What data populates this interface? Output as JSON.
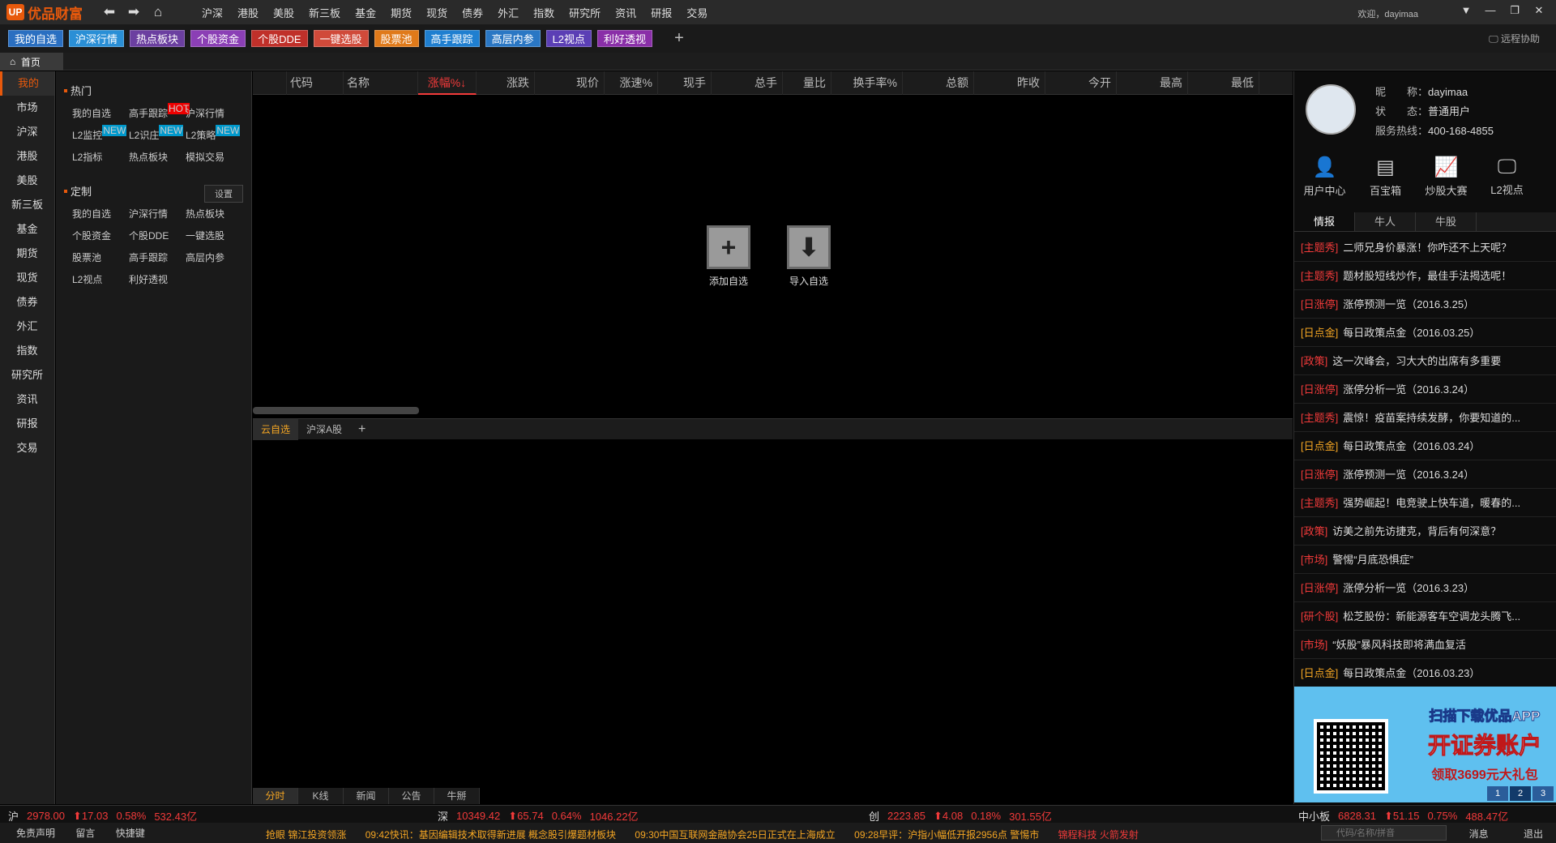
{
  "app": {
    "logo_badge": "UP",
    "logo_text": "优品财富",
    "back": "⬅",
    "forward": "➡",
    "home": "⌂"
  },
  "nav": [
    "沪深",
    "港股",
    "美股",
    "新三板",
    "基金",
    "期货",
    "现货",
    "债券",
    "外汇",
    "指数",
    "研究所",
    "资讯",
    "研报",
    "交易"
  ],
  "user_greeting": "欢迎，dayimaa",
  "window": {
    "menu": "▼",
    "min": "—",
    "restore": "❐",
    "close": "✕"
  },
  "toolbar": {
    "buttons": [
      {
        "label": "我的自选",
        "color": "#2a6fc1"
      },
      {
        "label": "沪深行情",
        "color": "#2a8fd6"
      },
      {
        "label": "热点板块",
        "color": "#6b3fa0"
      },
      {
        "label": "个股资金",
        "color": "#8b3fb5"
      },
      {
        "label": "个股DDE",
        "color": "#c0302a"
      },
      {
        "label": "一键选股",
        "color": "#d04a3a"
      },
      {
        "label": "股票池",
        "color": "#e07a1a"
      },
      {
        "label": "高手跟踪",
        "color": "#1f7fd0"
      },
      {
        "label": "高层内参",
        "color": "#2a77c4"
      },
      {
        "label": "L2视点",
        "color": "#5b3fb5"
      },
      {
        "label": "利好透视",
        "color": "#8a2fa8"
      }
    ],
    "plus": "+",
    "remote": "远程协助"
  },
  "home_tab": "首页",
  "leftnav": [
    "我的",
    "市场",
    "沪深",
    "港股",
    "美股",
    "新三板",
    "基金",
    "期货",
    "现货",
    "债券",
    "外汇",
    "指数",
    "研究所",
    "资讯",
    "研报",
    "交易"
  ],
  "panel": {
    "hot_title": "热门",
    "hot_items": [
      {
        "label": "我的自选",
        "badge": ""
      },
      {
        "label": "高手跟踪",
        "badge": "HOT"
      },
      {
        "label": "沪深行情",
        "badge": ""
      },
      {
        "label": "L2监控",
        "badge": "NEW"
      },
      {
        "label": "L2识庄",
        "badge": "NEW"
      },
      {
        "label": "L2策略",
        "badge": "NEW"
      },
      {
        "label": "L2指标",
        "badge": ""
      },
      {
        "label": "热点板块",
        "badge": ""
      },
      {
        "label": "模拟交易",
        "badge": ""
      }
    ],
    "custom_title": "定制",
    "settings": "设置",
    "custom_items": [
      "我的自选",
      "沪深行情",
      "热点板块",
      "个股资金",
      "个股DDE",
      "一键选股",
      "股票池",
      "高手跟踪",
      "高层内参",
      "L2视点",
      "利好透视"
    ]
  },
  "table": {
    "columns": [
      "代码",
      "名称",
      "涨幅%↓",
      "涨跌",
      "现价",
      "涨速%",
      "现手",
      "总手",
      "量比",
      "换手率%",
      "总额",
      "昨收",
      "今开",
      "最高",
      "最低"
    ]
  },
  "actions": {
    "add": "添加自选",
    "import": "导入自选"
  },
  "subtabs": [
    "云自选",
    "沪深A股",
    "+"
  ],
  "bottomtabs": [
    "分时",
    "K线",
    "新闻",
    "公告",
    "牛掰"
  ],
  "profile": {
    "nick_label": "昵　　称：",
    "nick": "dayimaa",
    "status_label": "状　　态：",
    "status": "普通用户",
    "hotline_label": "服务热线：",
    "hotline": "400-168-4855"
  },
  "quick": [
    {
      "label": "用户中心",
      "icon": "person-icon"
    },
    {
      "label": "百宝箱",
      "icon": "box-icon"
    },
    {
      "label": "炒股大赛",
      "icon": "chart-icon"
    },
    {
      "label": "L2视点",
      "icon": "monitor-icon"
    }
  ],
  "rtabs": [
    "情报",
    "牛人",
    "牛股"
  ],
  "news": [
    {
      "tag": "[主题秀]",
      "text": "二师兄身价暴涨！你咋还不上天呢？",
      "color": "#f23a3a"
    },
    {
      "tag": "[主题秀]",
      "text": "题材股短线炒作，最佳手法揭选呢！",
      "color": "#f23a3a"
    },
    {
      "tag": "[日涨停]",
      "text": "涨停预测一览（2016.3.25）",
      "color": "#f23a3a"
    },
    {
      "tag": "[日点金]",
      "text": "每日政策点金（2016.03.25）",
      "color": "#f5a623"
    },
    {
      "tag": "[政策]",
      "text": "这一次峰会，习大大的出席有多重要",
      "color": "#f23a3a"
    },
    {
      "tag": "[日涨停]",
      "text": "涨停分析一览（2016.3.24）",
      "color": "#f23a3a"
    },
    {
      "tag": "[主题秀]",
      "text": "震惊！疫苗案持续发酵，你要知道的...",
      "color": "#f23a3a"
    },
    {
      "tag": "[日点金]",
      "text": "每日政策点金（2016.03.24）",
      "color": "#f5a623"
    },
    {
      "tag": "[日涨停]",
      "text": "涨停预测一览（2016.3.24）",
      "color": "#f23a3a"
    },
    {
      "tag": "[主题秀]",
      "text": "强势崛起！电竞驶上快车道，暖春的...",
      "color": "#f23a3a"
    },
    {
      "tag": "[政策]",
      "text": "访美之前先访捷克，背后有何深意？",
      "color": "#f23a3a"
    },
    {
      "tag": "[市场]",
      "text": "警惕“月底恐惧症”",
      "color": "#f23a3a"
    },
    {
      "tag": "[日涨停]",
      "text": "涨停分析一览（2016.3.23）",
      "color": "#f23a3a"
    },
    {
      "tag": "[研个股]",
      "text": "松芝股份：新能源客车空调龙头腾飞...",
      "color": "#f23a3a"
    },
    {
      "tag": "[市场]",
      "text": "“妖股”暴风科技即将满血复活",
      "color": "#f23a3a"
    },
    {
      "tag": "[日点金]",
      "text": "每日政策点金（2016.03.23）",
      "color": "#f5a623"
    }
  ],
  "ad": {
    "line1": "扫描下载优品APP",
    "line2": "开证券账户",
    "line3": "领取3699元大礼包",
    "pages": [
      "1",
      "2",
      "3"
    ]
  },
  "indices": [
    {
      "name": "沪",
      "price": "2978.00",
      "chg": "⬆17.03",
      "pct": "0.58%",
      "amt": "532.43亿"
    },
    {
      "name": "深",
      "price": "10349.42",
      "chg": "⬆65.74",
      "pct": "0.64%",
      "amt": "1046.22亿"
    },
    {
      "name": "创",
      "price": "2223.85",
      "chg": "⬆4.08",
      "pct": "0.18%",
      "amt": "301.55亿"
    },
    {
      "name": "中小板",
      "price": "6828.31",
      "chg": "⬆51.15",
      "pct": "0.75%",
      "amt": "488.47亿"
    }
  ],
  "status": {
    "disclaimer": "免责声明",
    "message": "留言",
    "shortcut": "快捷键",
    "ticker": [
      "抢眼 锦江投资领涨",
      "09:42快讯：基因编辑技术取得新进展 概念股引爆题材板块",
      "09:30中国互联网金融协会25日正式在上海成立",
      "09:28早评：沪指小幅低开报2956点 警惕市",
      "锦程科技 火箭发射"
    ],
    "search_placeholder": "代码/名称/拼音",
    "logout": "消息",
    "logout2": "退出"
  }
}
